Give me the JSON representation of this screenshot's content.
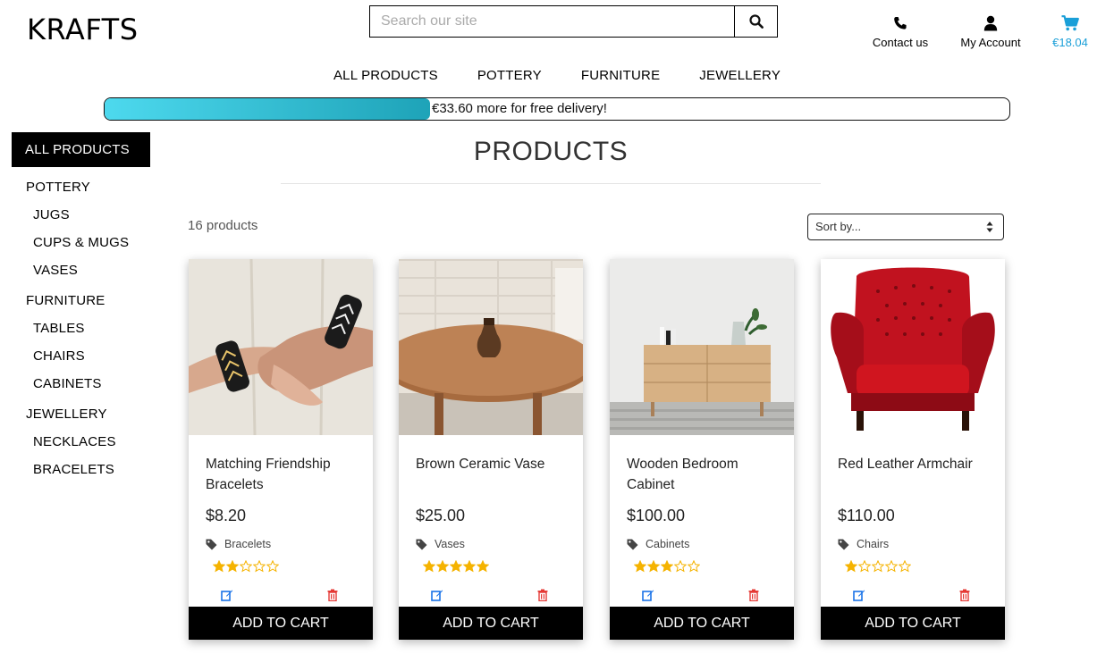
{
  "header": {
    "logo": "KRAFTS",
    "search_placeholder": "Search our site",
    "contact_label": "Contact us",
    "account_label": "My Account",
    "cart_total": "€18.04"
  },
  "nav": [
    "ALL PRODUCTS",
    "POTTERY",
    "FURNITURE",
    "JEWELLERY"
  ],
  "delivery": {
    "message": "€33.60 more for free delivery!",
    "progress_fraction": 0.36
  },
  "sidebar": {
    "active": "ALL PRODUCTS",
    "categories": [
      {
        "label": "POTTERY",
        "subs": [
          "JUGS",
          "CUPS & MUGS",
          "VASES"
        ]
      },
      {
        "label": "FURNITURE",
        "subs": [
          "TABLES",
          "CHAIRS",
          "CABINETS"
        ]
      },
      {
        "label": "JEWELLERY",
        "subs": [
          "NECKLACES",
          "BRACELETS"
        ]
      }
    ]
  },
  "main": {
    "title": "PRODUCTS",
    "count": "16 products",
    "sort_label": "Sort by..."
  },
  "products": [
    {
      "name": "Matching Friendship Bracelets",
      "price": "$8.20",
      "category": "Bracelets",
      "rating": 2,
      "add_label": "ADD TO CART"
    },
    {
      "name": "Brown Ceramic Vase",
      "price": "$25.00",
      "category": "Vases",
      "rating": 5,
      "add_label": "ADD TO CART"
    },
    {
      "name": "Wooden Bedroom Cabinet",
      "price": "$100.00",
      "category": "Cabinets",
      "rating": 3,
      "add_label": "ADD TO CART"
    },
    {
      "name": "Red Leather Armchair",
      "price": "$110.00",
      "category": "Chairs",
      "rating": 1,
      "add_label": "ADD TO CART"
    }
  ],
  "colors": {
    "accent": "#1a9fd8",
    "progress_start": "#4dd9ee",
    "progress_end": "#1ea3b8",
    "star": "#f5b301",
    "edit": "#1a73e8",
    "delete": "#e53935"
  },
  "icons": [
    "search-icon",
    "phone-icon",
    "user-icon",
    "cart-icon",
    "tag-icon",
    "star-icon",
    "edit-icon",
    "trash-icon",
    "sort-arrows-icon"
  ]
}
